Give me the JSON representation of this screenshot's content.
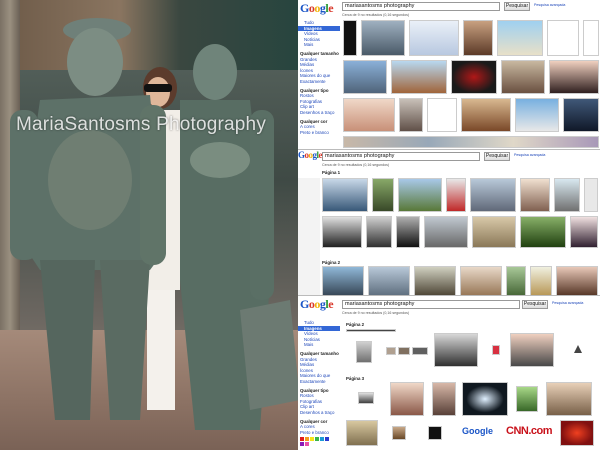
{
  "photo": {
    "watermark": "MariaSantosms Photography",
    "accent": "#4d6b65"
  },
  "google": {
    "logo_letters": [
      "G",
      "o",
      "o",
      "g",
      "l",
      "e"
    ],
    "search_query": "mariasantosms photography",
    "search_button": "Pesquisar",
    "advanced_link": "Pesquisa avançada",
    "prefs_link": "Preferências",
    "result_meta": "Cerca de 9 no resultados (0,16 segundos)"
  },
  "sidebar": {
    "items": [
      "Tudo",
      "Imagens",
      "Vídeos",
      "Notícias",
      "Mais"
    ],
    "size_head": "Qualquer tamanho",
    "size_opts": [
      "Grandes",
      "Médias",
      "Ícones",
      "Maiores do que",
      "Exactamente"
    ],
    "type_head": "Qualquer tipo",
    "type_opts": [
      "Rostos",
      "Fotografias",
      "Clip art",
      "Desenhos a traço"
    ],
    "color_head": "Qualquer cor",
    "color_opts": [
      "A cores",
      "Preto e branco"
    ]
  },
  "screen2": {
    "page1": "Página 1",
    "page2": "Página 2"
  },
  "screen3": {
    "page2": "Página 2",
    "page3": "Página 3",
    "google_word": "Google",
    "cnn_word": "CNN.com"
  },
  "colors": {
    "swatches": [
      "#e21a1a",
      "#f39a1c",
      "#f4e41a",
      "#39b54a",
      "#1a9ad6",
      "#2a3ccf",
      "#8b1ab8",
      "#e84fa8",
      "#ffffff",
      "#9a9a9a",
      "#000000",
      "#7a4a1e"
    ]
  }
}
